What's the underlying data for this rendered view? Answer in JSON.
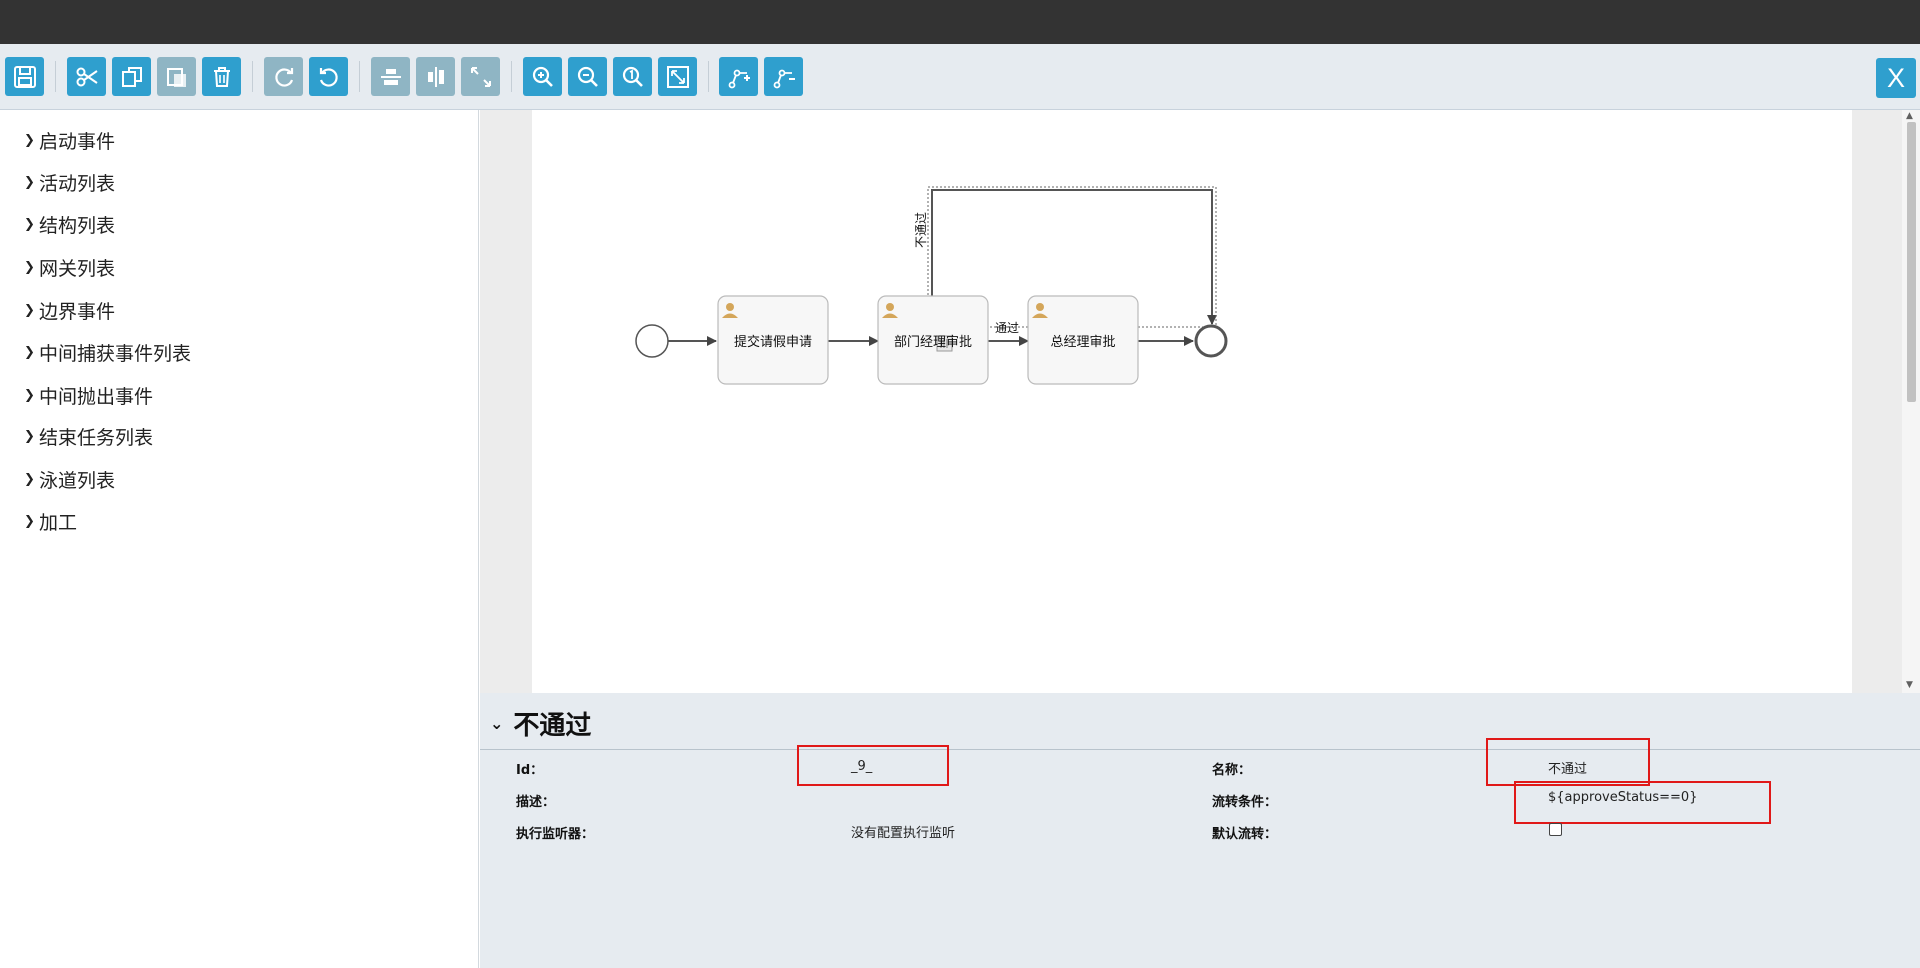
{
  "toolbar": {
    "buttons": [
      {
        "name": "save-button",
        "icon": "save-icon"
      },
      {
        "name": "cut-button",
        "icon": "scissors-icon"
      },
      {
        "name": "copy-button",
        "icon": "copy-icon"
      },
      {
        "name": "paste-button",
        "icon": "paste-icon"
      },
      {
        "name": "delete-button",
        "icon": "trash-icon"
      },
      {
        "name": "redo-button",
        "icon": "redo-icon"
      },
      {
        "name": "undo-button",
        "icon": "undo-icon"
      },
      {
        "name": "align-vertical-button",
        "icon": "align-vertical-icon"
      },
      {
        "name": "align-horizontal-button",
        "icon": "align-horizontal-icon"
      },
      {
        "name": "same-size-button",
        "icon": "resize-icon"
      },
      {
        "name": "zoom-in-button",
        "icon": "zoom-in-icon"
      },
      {
        "name": "zoom-out-button",
        "icon": "zoom-out-icon"
      },
      {
        "name": "zoom-actual-button",
        "icon": "zoom-actual-icon"
      },
      {
        "name": "zoom-fit-button",
        "icon": "fit-screen-icon"
      },
      {
        "name": "add-docker-button",
        "icon": "add-bend-icon"
      },
      {
        "name": "remove-docker-button",
        "icon": "remove-bend-icon"
      }
    ],
    "close_label": "X",
    "accent": "#2f9fce"
  },
  "palette": {
    "items": [
      "启动事件",
      "活动列表",
      "结构列表",
      "网关列表",
      "边界事件",
      "中间捕获事件列表",
      "中间抛出事件",
      "结束任务列表",
      "泳道列表",
      "加工"
    ]
  },
  "diagram": {
    "tasks": [
      "提交请假申请",
      "部门经理审批",
      "总经理审批"
    ],
    "flow_labels": {
      "pass": "通过",
      "reject": "不通过"
    },
    "task_icon": "user-icon"
  },
  "properties": {
    "title": "不通过",
    "id_label": "Id：",
    "id_value": "_9_",
    "name_label": "名称：",
    "name_value": "不通过",
    "desc_label": "描述：",
    "desc_value": "",
    "condition_label": "流转条件：",
    "condition_value": "${approveStatus==0}",
    "listener_label": "执行监听器：",
    "listener_value": "没有配置执行监听",
    "default_label": "默认流转：",
    "default_checked": false,
    "highlight_color": "#e01818"
  }
}
